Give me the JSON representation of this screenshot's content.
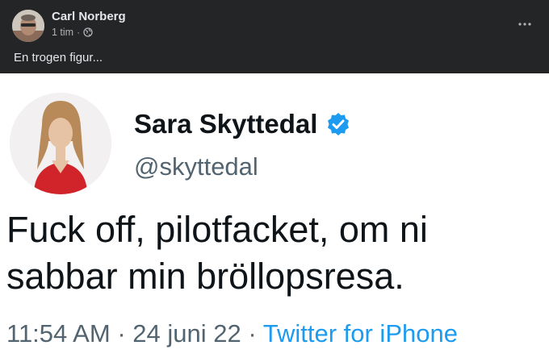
{
  "post": {
    "author": "Carl Norberg",
    "time": "1 tim",
    "separator": "·",
    "privacy_icon": "globe-icon",
    "more_icon": "ellipsis-icon",
    "text": "En trogen figur..."
  },
  "tweet": {
    "name": "Sara Skyttedal",
    "verified_icon": "verified-badge-icon",
    "handle": "@skyttedal",
    "text": "Fuck off, pilotfacket, om ni sabbar min bröllopsresa.",
    "time": "11:54 AM",
    "date": "24 juni 22",
    "separator": "·",
    "source": "Twitter for iPhone"
  },
  "colors": {
    "fb_background": "#242526",
    "fb_text": "#e4e6eb",
    "fb_secondary": "#b0b3b8",
    "tw_link": "#1d9bf0",
    "tw_secondary": "#536471"
  }
}
